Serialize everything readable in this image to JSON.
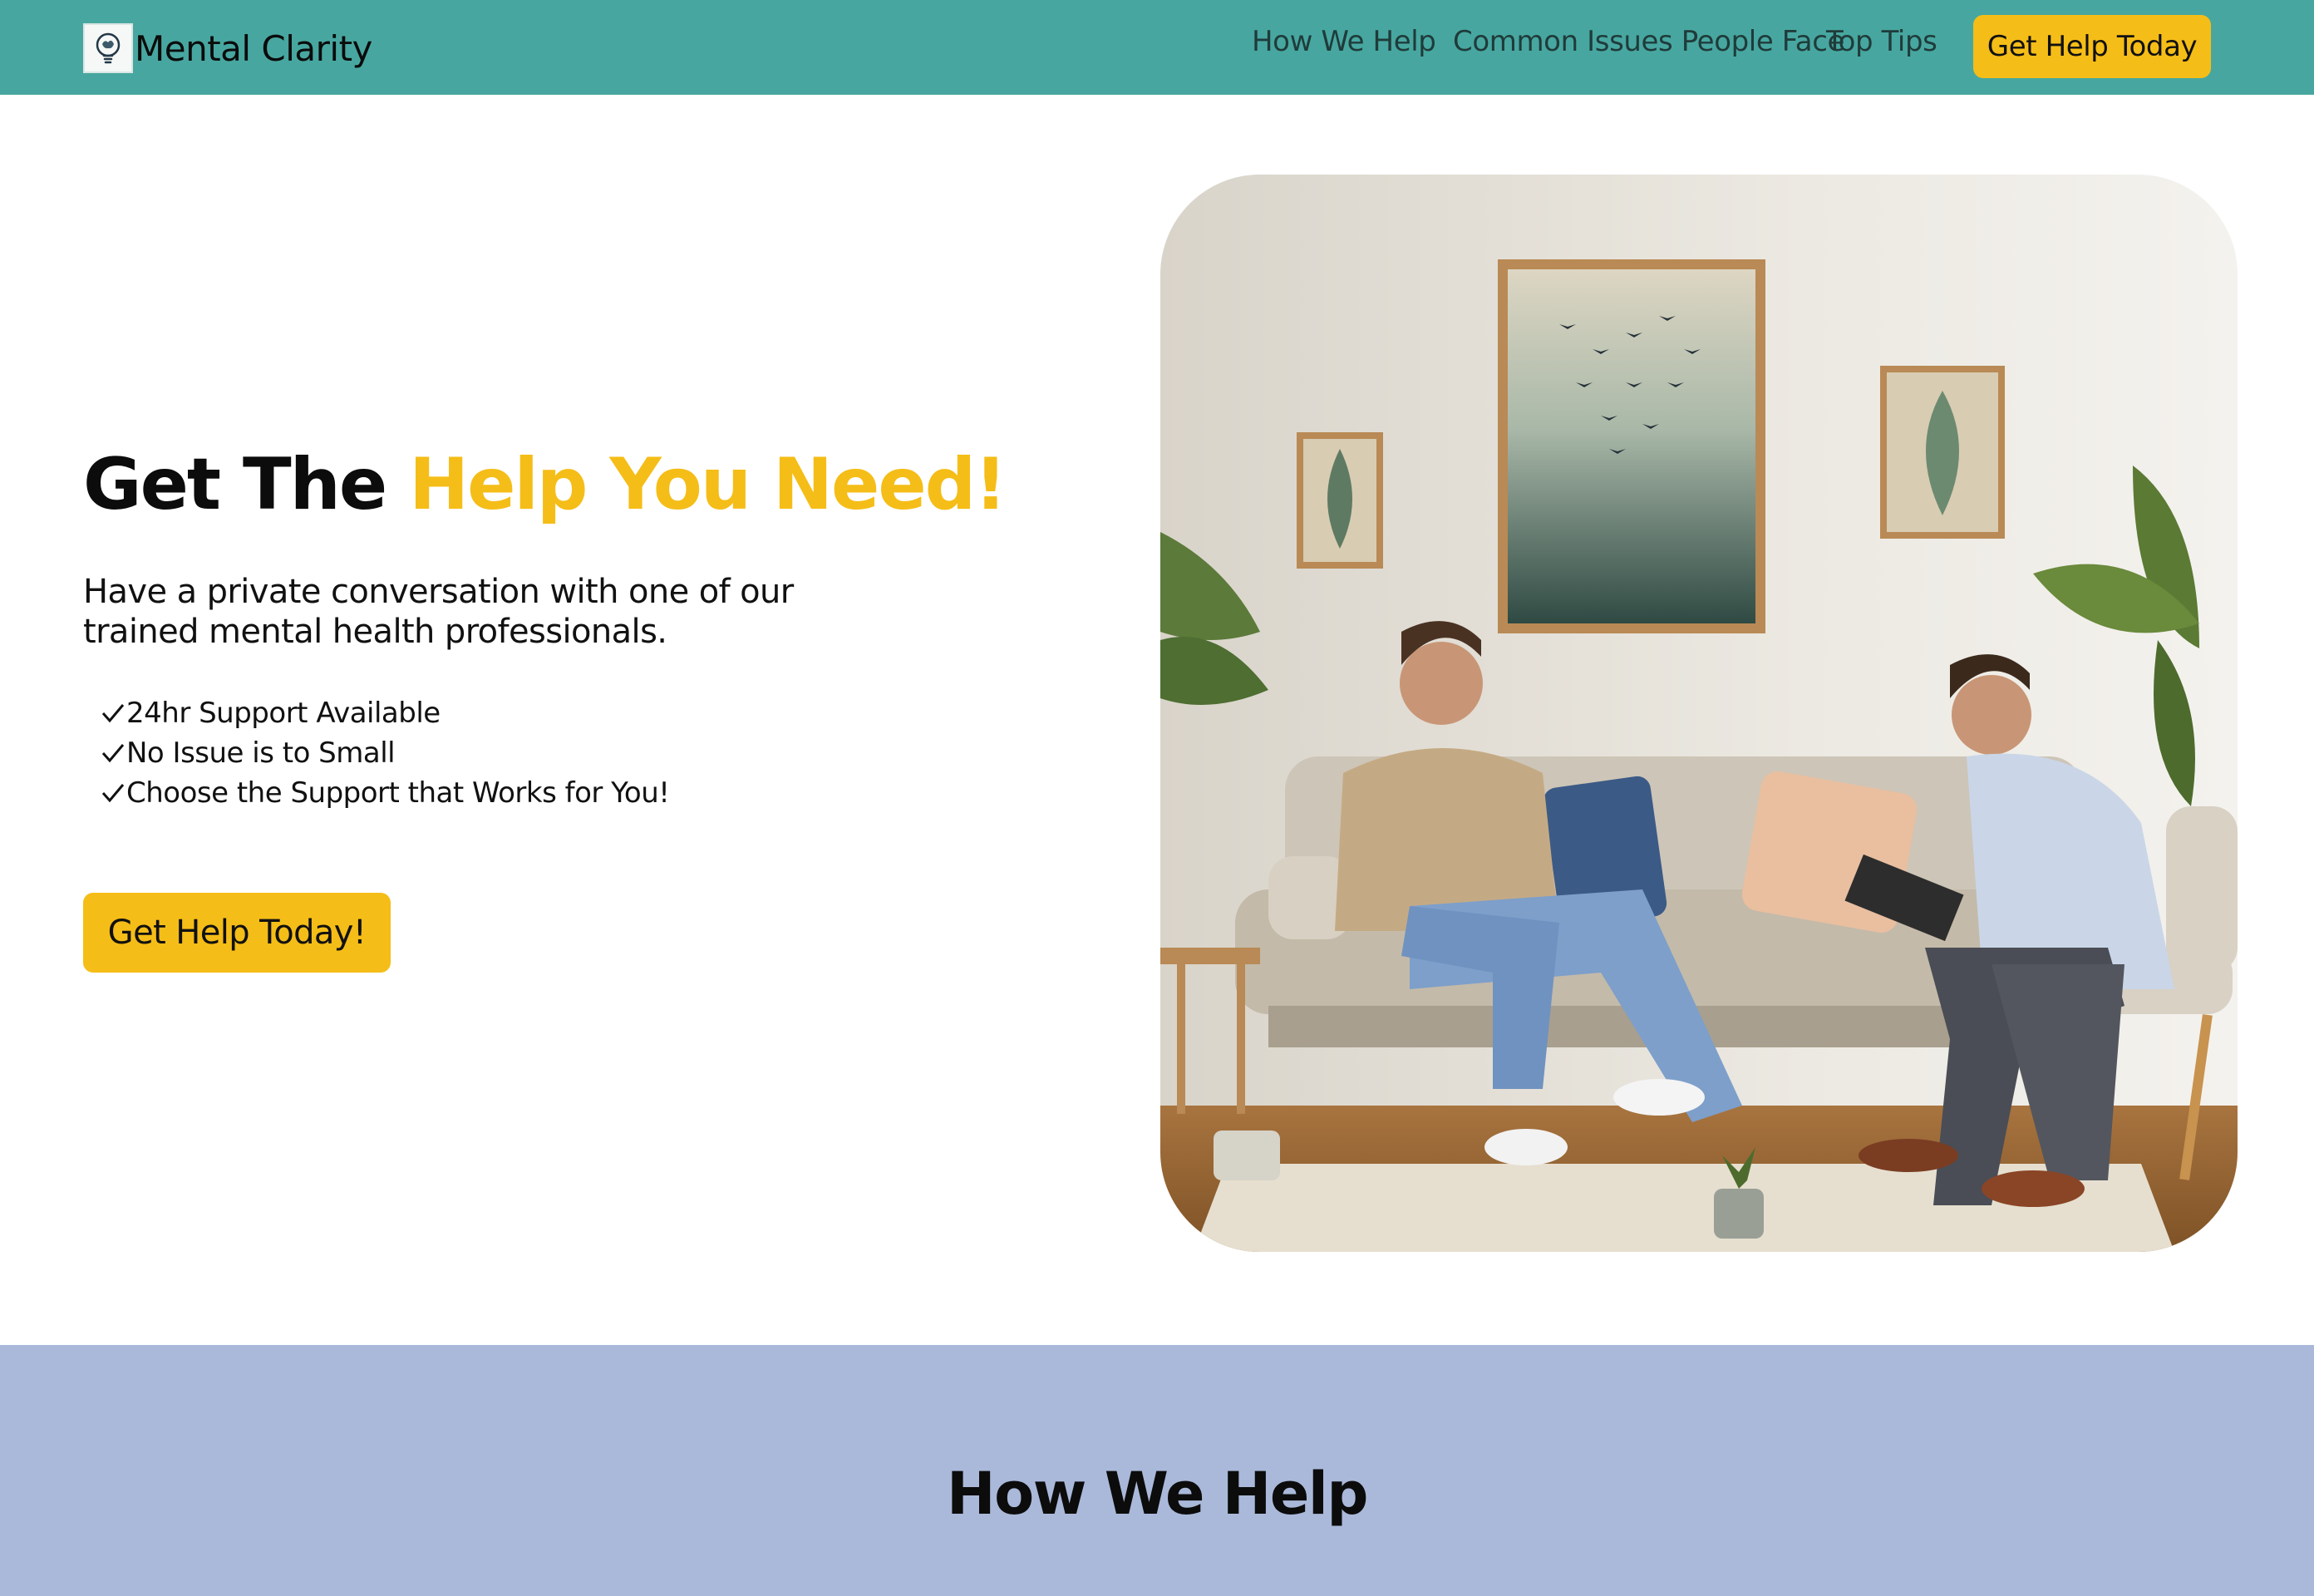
{
  "brand": {
    "name": "Mental Clarity",
    "logo_icon": "brain-lightbulb-icon"
  },
  "nav": {
    "links": [
      "How We Help",
      "Common Issues People Face",
      "Top Tips"
    ],
    "cta": "Get Help Today"
  },
  "hero": {
    "title_plain": "Get The",
    "title_accent": "Help You Need!",
    "subtitle": "Have a private conversation with one of our trained mental health professionals.",
    "features": [
      "24hr Support Available",
      "No Issue is to Small",
      "Choose the Support that Works for You!"
    ],
    "feature_icon": "checkmark-icon",
    "cta": "Get Help Today!"
  },
  "section": {
    "title": "How We Help"
  },
  "colors": {
    "navbar": "#47a7a0",
    "accent": "#f5bd17",
    "section_bg": "#aab9da"
  }
}
